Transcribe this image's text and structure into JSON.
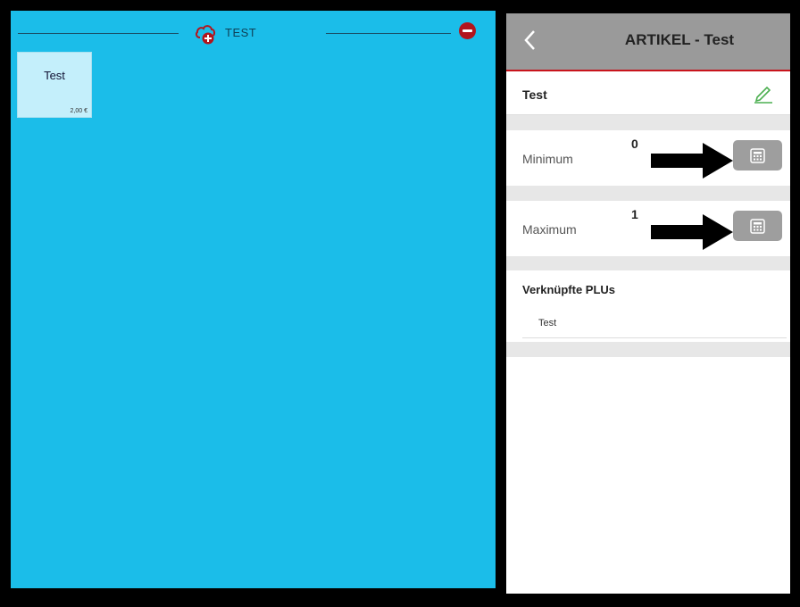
{
  "left": {
    "group_title": "TEST",
    "tile": {
      "name": "Test",
      "price": "2,00 €"
    }
  },
  "right": {
    "title": "ARTIKEL - Test",
    "article_name": "Test",
    "minimum": {
      "label": "Minimum",
      "value": "0"
    },
    "maximum": {
      "label": "Maximum",
      "value": "1"
    },
    "plus": {
      "title": "Verknüpfte PLUs",
      "items": [
        "Test"
      ]
    }
  },
  "colors": {
    "left_background": "#1bbde9",
    "tile_background": "#c4effb",
    "header_background": "#9a9a9a",
    "accent_red": "#c8141c",
    "edit_green": "#4caf50"
  },
  "icons": [
    "cloud-plus-icon",
    "remove-icon",
    "back-icon",
    "edit-pencil-icon",
    "calculator-icon",
    "arrow-icon"
  ]
}
